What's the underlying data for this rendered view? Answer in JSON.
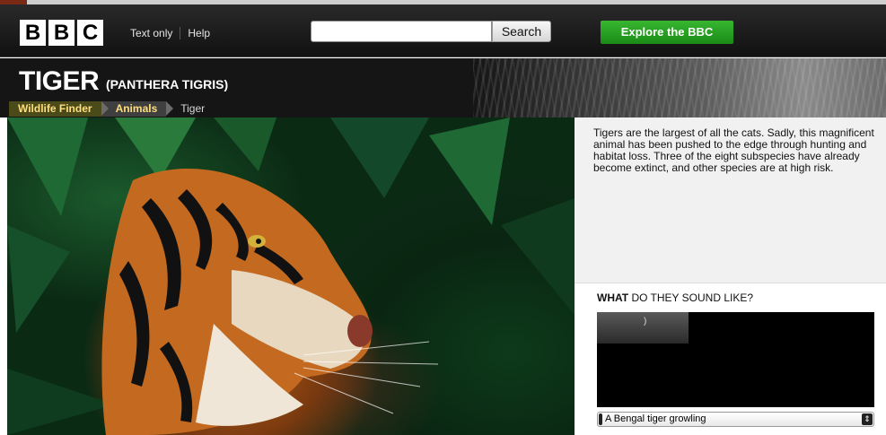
{
  "header": {
    "logo_letters": [
      "B",
      "B",
      "C"
    ],
    "text_only_label": "Text only",
    "help_label": "Help",
    "search_placeholder": "",
    "search_button_label": "Search",
    "explore_label": "Explore the BBC"
  },
  "page": {
    "title": "TIGER",
    "scientific_name": "(PANTHERA TIGRIS)"
  },
  "breadcrumb": [
    {
      "label": "Wildlife Finder"
    },
    {
      "label": "Animals"
    },
    {
      "label": "Tiger"
    }
  ],
  "description": "Tigers are the largest of all the cats. Sadly, this magnificent animal has been pushed to the edge through hunting and habitat loss. Three of the eight subspecies have already become extinct, and other species are at high risk.",
  "sound": {
    "title_bold": "WHAT",
    "title_rest": " DO THEY SOUND LIKE?",
    "selected_option": "A Bengal tiger growling"
  },
  "colors": {
    "explore_green": "#1f9a1b",
    "breadcrumb_text": "#ffde7d"
  },
  "icons": {
    "select_arrows": "updown-arrows-icon"
  }
}
